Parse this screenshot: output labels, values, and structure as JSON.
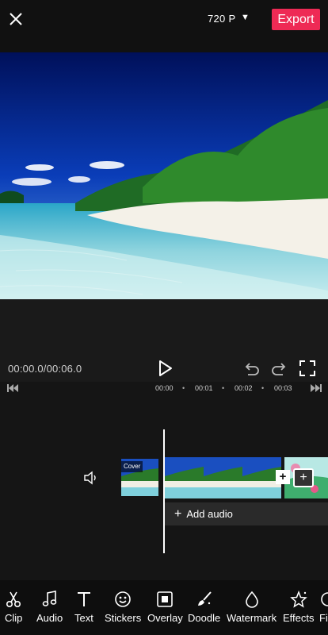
{
  "header": {
    "resolution": "720 P",
    "resolution_arrow": "▼",
    "export_label": "Export"
  },
  "player": {
    "timecode": "00:00.0/00:06.0"
  },
  "ruler": {
    "ticks": [
      "00:00",
      "00:01",
      "00:02",
      "00:03"
    ],
    "dot": "•"
  },
  "timeline": {
    "cover_label": "Cover",
    "add_audio_plus": "+",
    "add_audio_label": "Add audio",
    "plus": "+"
  },
  "toolbar": {
    "items": [
      {
        "label": "Clip",
        "icon": "scissors-icon"
      },
      {
        "label": "Audio",
        "icon": "music-note-icon"
      },
      {
        "label": "Text",
        "icon": "text-icon"
      },
      {
        "label": "Stickers",
        "icon": "smiley-icon"
      },
      {
        "label": "Overlay",
        "icon": "overlay-icon"
      },
      {
        "label": "Doodle",
        "icon": "brush-icon"
      },
      {
        "label": "Watermark",
        "icon": "droplet-icon"
      },
      {
        "label": "Effects",
        "icon": "sparkle-star-icon"
      },
      {
        "label": "Fi",
        "icon": "filter-icon"
      }
    ]
  },
  "colors": {
    "accent": "#ee2a55",
    "background": "#151515"
  }
}
